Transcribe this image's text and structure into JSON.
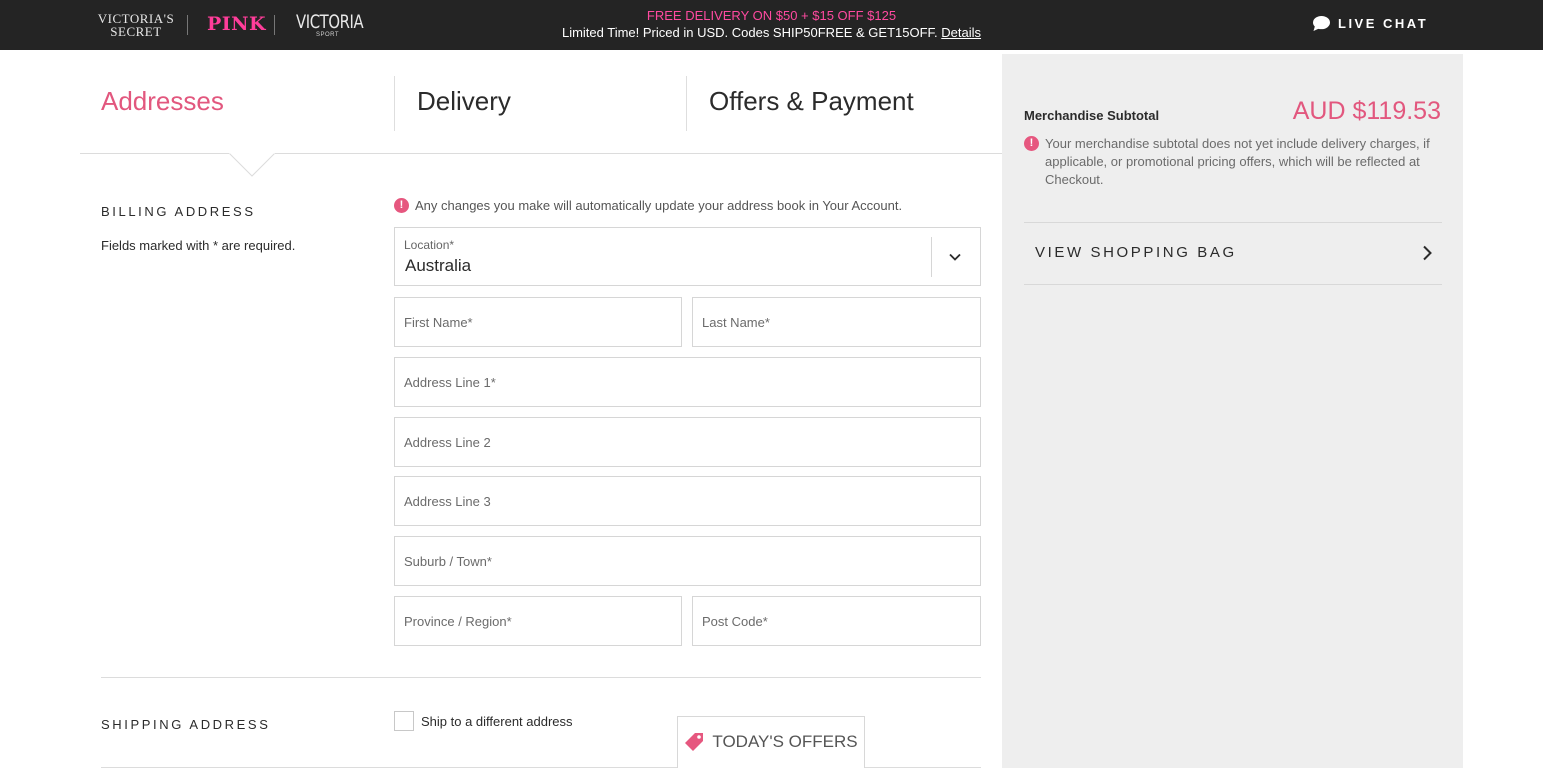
{
  "header": {
    "brands": {
      "vs_line1": "VICTORIA'S",
      "vs_line2": "SECRET",
      "pink": "PINK",
      "victoria_sport": "VICTORIA",
      "sport_sub": "SPORT"
    },
    "promo_line1": "FREE DELIVERY ON $50 + $15 OFF $125",
    "promo_line2": "Limited Time! Priced in USD. Codes SHIP50FREE & GET15OFF.",
    "promo_link": "Details",
    "live_chat": "LIVE CHAT",
    "colors": {
      "bar": "#242424",
      "accent": "#ff4aa0"
    }
  },
  "steps": [
    {
      "label": "Addresses",
      "active": true
    },
    {
      "label": "Delivery",
      "active": false
    },
    {
      "label": "Offers & Payment",
      "active": false
    }
  ],
  "billing": {
    "heading": "BILLING ADDRESS",
    "required_note": "Fields marked with * are required.",
    "account_note": "Any changes you make will automatically update your address book in Your Account.",
    "location_label": "Location*",
    "location_value": "Australia",
    "fields": {
      "first_name": "First Name*",
      "last_name": "Last Name*",
      "address1": "Address Line 1*",
      "address2": "Address Line 2",
      "address3": "Address Line 3",
      "suburb": "Suburb / Town*",
      "province": "Province / Region*",
      "postcode": "Post Code*"
    }
  },
  "shipping": {
    "heading": "SHIPPING ADDRESS",
    "checkbox_label": "Ship to a different address",
    "checked": false
  },
  "offers_tab": {
    "label": "TODAY'S OFFERS",
    "icon": "tag-icon"
  },
  "summary": {
    "subtotal_label": "Merchandise Subtotal",
    "subtotal_value": "AUD $119.53",
    "note": "Your merchandise subtotal does not yet include delivery charges, if applicable, or promotional pricing offers, which will be reflected at Checkout.",
    "view_bag": "VIEW SHOPPING BAG"
  },
  "alert_glyph": "!",
  "accent_color": "#e2577e"
}
